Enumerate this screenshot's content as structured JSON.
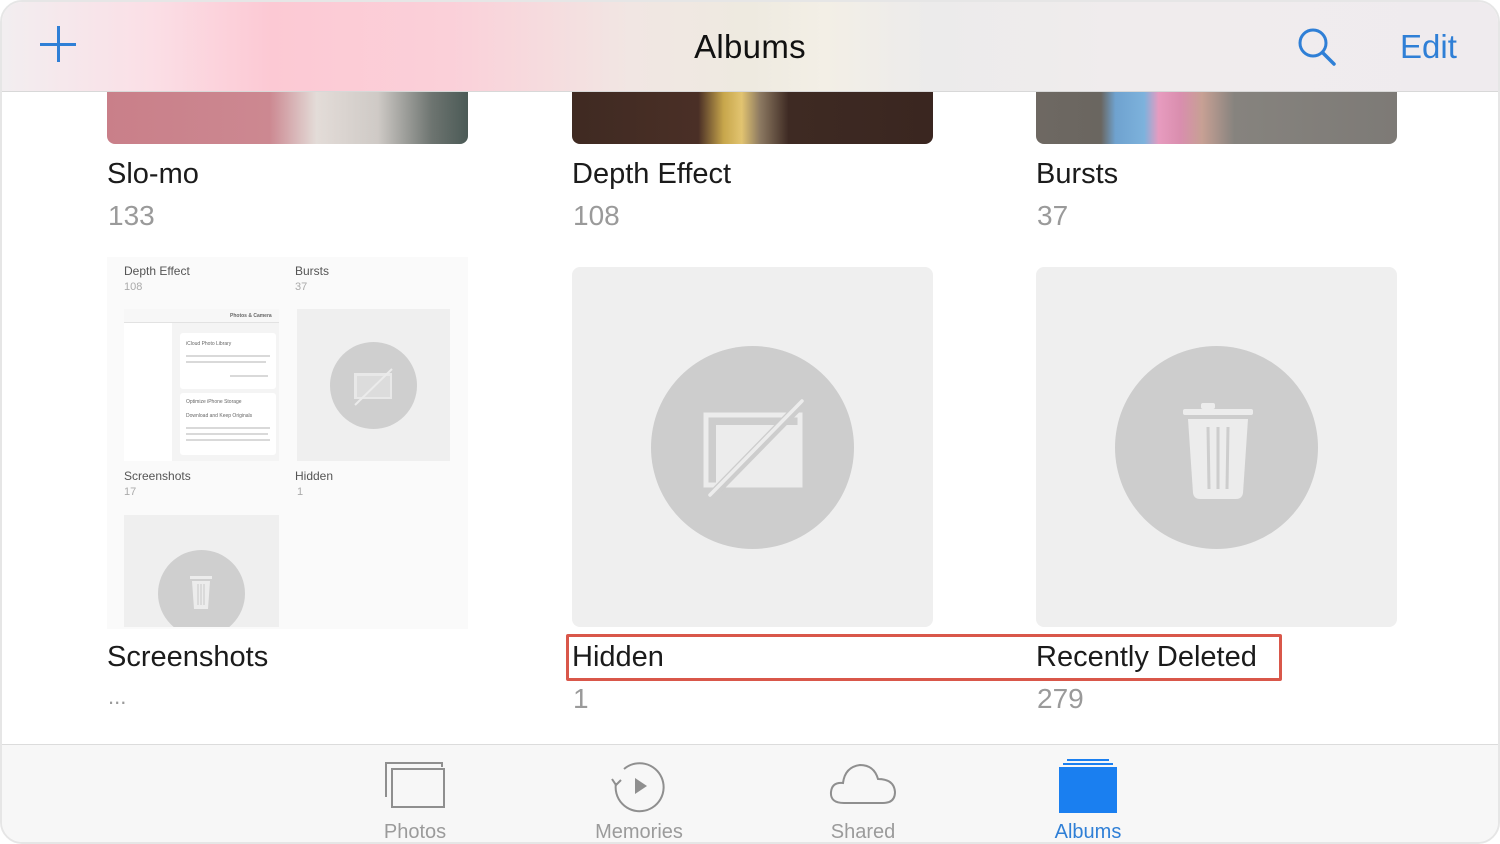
{
  "navbar": {
    "title": "Albums",
    "add_icon": "plus-icon",
    "search_icon": "search-icon",
    "edit_label": "Edit",
    "accent_color": "#2f7fd6"
  },
  "albums": [
    {
      "name": "Slo-mo",
      "count": "133"
    },
    {
      "name": "Depth Effect",
      "count": "108"
    },
    {
      "name": "Bursts",
      "count": "37"
    },
    {
      "name": "Screenshots",
      "count": "..."
    },
    {
      "name": "Hidden",
      "count": "1",
      "icon": "hidden-photo-icon"
    },
    {
      "name": "Recently Deleted",
      "count": "279",
      "icon": "trash-icon"
    }
  ],
  "screenshot_thumbnail": {
    "items": [
      {
        "name": "Depth Effect",
        "count": "108"
      },
      {
        "name": "Bursts",
        "count": "37"
      },
      {
        "name": "Screenshots",
        "count": "17"
      },
      {
        "name": "Hidden",
        "count": "1"
      }
    ],
    "settings_header": "Photos & Camera",
    "settings_rows": [
      "iCloud Photo Library",
      "Optimize iPhone Storage",
      "Download and Keep Originals"
    ]
  },
  "highlight": {
    "color": "#d9574a",
    "targets": [
      "Hidden",
      "Recently Deleted"
    ]
  },
  "tabbar": {
    "tabs": [
      {
        "label": "Photos",
        "icon": "photos-icon",
        "active": false
      },
      {
        "label": "Memories",
        "icon": "memories-icon",
        "active": false
      },
      {
        "label": "Shared",
        "icon": "cloud-icon",
        "active": false
      },
      {
        "label": "Albums",
        "icon": "albums-icon",
        "active": true
      }
    ]
  }
}
